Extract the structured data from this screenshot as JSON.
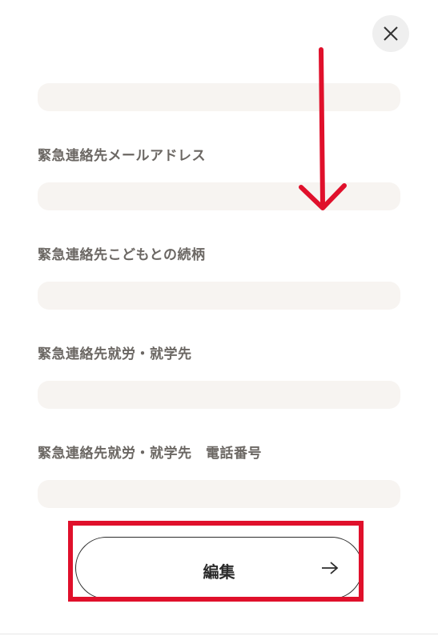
{
  "icons": {
    "close": "close-icon",
    "edit_arrow": "arrow-right-icon"
  },
  "form": {
    "fields": [
      {
        "label": "",
        "value": ""
      },
      {
        "label": "緊急連絡先メールアドレス",
        "value": ""
      },
      {
        "label": "緊急連絡先こどもとの続柄",
        "value": ""
      },
      {
        "label": "緊急連絡先就労・就学先",
        "value": ""
      },
      {
        "label": "緊急連絡先就労・就学先　電話番号",
        "value": ""
      }
    ]
  },
  "actions": {
    "edit_label": "編集"
  },
  "annotations": {
    "color": "#e0102b"
  }
}
